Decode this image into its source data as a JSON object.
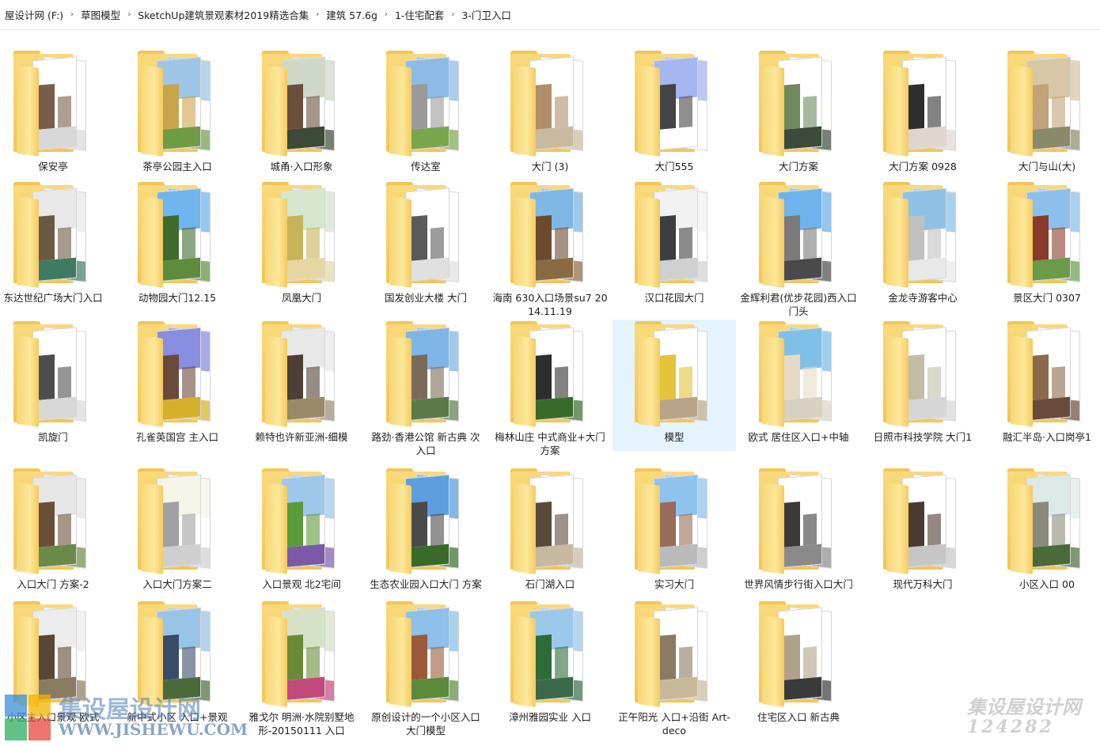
{
  "breadcrumb": [
    "屋设计网 (F:)",
    "草图模型",
    "SketchUp建筑景观素材2019精选合集",
    "建筑 57.6g",
    "1-住宅配套",
    "3-门卫入口"
  ],
  "folders": [
    {
      "label": "保安亭",
      "sky": "#ffffff",
      "ground": "#d8d8d8",
      "b": "#7a5c4a"
    },
    {
      "label": "茶亭公园主入口",
      "sky": "#9fc6e6",
      "ground": "#6f9a46",
      "b": "#c9a44a"
    },
    {
      "label": "城甬·入口形象",
      "sky": "#cfd8c8",
      "ground": "#3d4a35",
      "b": "#6a4f3a"
    },
    {
      "label": "传达室",
      "sky": "#8dbbe8",
      "ground": "#79a54c",
      "b": "#9a9a9a"
    },
    {
      "label": "大门 (3)",
      "sky": "#ffffff",
      "ground": "#c9b9a0",
      "b": "#b08e6a"
    },
    {
      "label": "大门555",
      "sky": "#a6b6ee",
      "ground": "#ffffff",
      "b": "#444444"
    },
    {
      "label": "大门方案",
      "sky": "#ffffff",
      "ground": "#3b4a3a",
      "b": "#6d8a5c"
    },
    {
      "label": "大门方案 0928",
      "sky": "#ffffff",
      "ground": "#e0d6d0",
      "b": "#2e2e2e"
    },
    {
      "label": "大门与山(大)",
      "sky": "#d8c7a6",
      "ground": "#8a8a6a",
      "b": "#c2a278"
    },
    {
      "label": "东达世纪广场大门入口",
      "sky": "#e8e8e8",
      "ground": "#3f7a63",
      "b": "#6a5a42"
    },
    {
      "label": "动物园大门12.15",
      "sky": "#6fb5ee",
      "ground": "#5c8c3c",
      "b": "#3f6a2e"
    },
    {
      "label": "凤凰大门",
      "sky": "#d6e6cf",
      "ground": "#e6d6a2",
      "b": "#c9b35a"
    },
    {
      "label": "国发创业大楼 大门",
      "sky": "#ffffff",
      "ground": "#e0e0e0",
      "b": "#5a5a5a"
    },
    {
      "label": "海南 630入口场景su7 2014.11.19",
      "sky": "#7fb7e4",
      "ground": "#8a6a42",
      "b": "#6b4a2e"
    },
    {
      "label": "汉口花园大门",
      "sky": "#f2f2f2",
      "ground": "#d0d0d0",
      "b": "#3e3e3e"
    },
    {
      "label": "金辉利君(优步花园)西入口门头",
      "sky": "#6fb3ec",
      "ground": "#4a4a4a",
      "b": "#7a7a7a"
    },
    {
      "label": "金龙寺游客中心",
      "sky": "#8ec2e6",
      "ground": "#e8e8e8",
      "b": "#c0c0c0"
    },
    {
      "label": "景区大门 0307",
      "sky": "#8cc0ea",
      "ground": "#6a9a4a",
      "b": "#8a3a2a"
    },
    {
      "label": "凯旋门",
      "sky": "#ffffff",
      "ground": "#d8d8d8",
      "b": "#4e4e4e"
    },
    {
      "label": "孔雀英国宫 主入口",
      "sky": "#8a8ee0",
      "ground": "#d6b02a",
      "b": "#6a4a3a"
    },
    {
      "label": "赖特也许新亚洲-细模",
      "sky": "#e8e8e8",
      "ground": "#9a8a6a",
      "b": "#4e4036"
    },
    {
      "label": "路劲·香港公馆 新古典 次入口",
      "sky": "#7fb5e6",
      "ground": "#5a7a4a",
      "b": "#7a6a5a"
    },
    {
      "label": "梅林山庄 中式商业+大门方案",
      "sky": "#ffffff",
      "ground": "#3a6a2a",
      "b": "#2e2e2e"
    },
    {
      "label": "模型",
      "sky": "#ffffff",
      "ground": "#b9a48a",
      "b": "#e3c43a"
    },
    {
      "label": "欧式 居住区入口+中轴",
      "sky": "#7fc0e8",
      "ground": "#d8d0c0",
      "b": "#e6dac6"
    },
    {
      "label": "日照市科技学院 大门1",
      "sky": "#ffffff",
      "ground": "#d6d6d6",
      "b": "#c2bca8"
    },
    {
      "label": "融汇半岛·入口岗亭1",
      "sky": "#ffffff",
      "ground": "#6a4a3a",
      "b": "#8a6a4a"
    },
    {
      "label": "入口大门 方案-2",
      "sky": "#e6e6e6",
      "ground": "#6a8a4a",
      "b": "#6a4e36"
    },
    {
      "label": "入口大门方案二",
      "sky": "#f4f4e8",
      "ground": "#cfcfcf",
      "b": "#a0a0a0"
    },
    {
      "label": "入口景观 北2宅间",
      "sky": "#9ec7ec",
      "ground": "#7a5aa8",
      "b": "#5a9a3a"
    },
    {
      "label": "生态农业园入口大门 方案",
      "sky": "#5e9ee0",
      "ground": "#3a6a2a",
      "b": "#4a4a4a"
    },
    {
      "label": "石门湖入口",
      "sky": "#ffffff",
      "ground": "#c8b8a0",
      "b": "#5a4a3a"
    },
    {
      "label": "实习大门",
      "sky": "#8fc3ee",
      "ground": "#bababa",
      "b": "#9a6a5a"
    },
    {
      "label": "世界风情步行街入口大门",
      "sky": "#ffffff",
      "ground": "#8a8a8a",
      "b": "#3a3a3a"
    },
    {
      "label": "现代万科大门",
      "sky": "#ffffff",
      "ground": "#c6c6c6",
      "b": "#4a3a32"
    },
    {
      "label": "小区入口 00",
      "sky": "#dde8e8",
      "ground": "#4a6a3a",
      "b": "#8a8a7a"
    },
    {
      "label": "小区主入口景观 欧式",
      "sky": "#ececec",
      "ground": "#8a7a62",
      "b": "#5a4636"
    },
    {
      "label": "新中式小区 入口+景观",
      "sky": "#9ac4e6",
      "ground": "#4a6a3a",
      "b": "#3a4a6a"
    },
    {
      "label": "雅戈尔 明洲·水院别墅地形-20150111 入口",
      "sky": "#d6e2c6",
      "ground": "#c24a7a",
      "b": "#6a8a3a"
    },
    {
      "label": "原创设计的一个小区入口大门模型",
      "sky": "#8ec0ea",
      "ground": "#5a8a3a",
      "b": "#9a5a3a"
    },
    {
      "label": "漳州雅园实业 入口",
      "sky": "#9cc8ec",
      "ground": "#3a6a4a",
      "b": "#2e6a3a"
    },
    {
      "label": "正午阳光 入口+沿街 Art-deco",
      "sky": "#ffffff",
      "ground": "#c8b89a",
      "b": "#8a7a62"
    },
    {
      "label": "住宅区入口 新古典",
      "sky": "#ffffff",
      "ground": "#3a3a3a",
      "b": "#b0a288"
    }
  ],
  "selected_index": 23,
  "watermarks": {
    "left_brand": "集设屋设计网",
    "left_url": "WWW.JISHEWU.COM",
    "right_brand": "集设屋设计网",
    "right_id": "124282"
  }
}
